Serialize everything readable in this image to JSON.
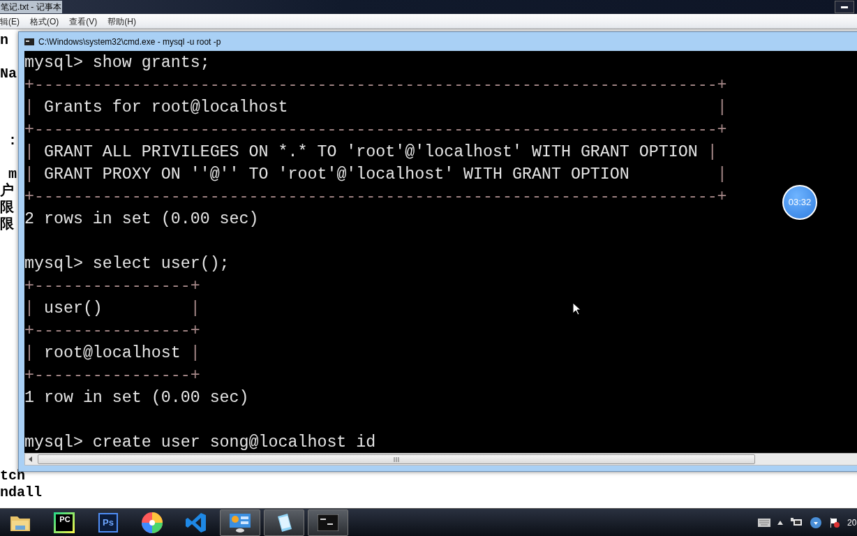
{
  "notepad": {
    "title": "笔记.txt - 记事本",
    "menu": [
      "辑(E)",
      "格式(O)",
      "查看(V)",
      "帮助(H)"
    ],
    "lines": [
      {
        "kind": "text",
        "text": "n"
      },
      {
        "kind": "blank"
      },
      {
        "kind": "text",
        "text": "Na"
      },
      {
        "kind": "blank"
      },
      {
        "kind": "blank"
      },
      {
        "kind": "blank"
      },
      {
        "kind": "text",
        "text": " :"
      },
      {
        "kind": "blank"
      },
      {
        "kind": "text",
        "text": " m"
      },
      {
        "kind": "text",
        "text": "户"
      },
      {
        "kind": "text",
        "text": "限"
      },
      {
        "kind": "text",
        "text": "限"
      },
      {
        "kind": "blank"
      },
      {
        "kind": "blank"
      },
      {
        "kind": "blank"
      },
      {
        "kind": "blank"
      },
      {
        "kind": "blank"
      },
      {
        "kind": "blank"
      },
      {
        "kind": "blank"
      },
      {
        "kind": "blank"
      },
      {
        "kind": "blank"
      },
      {
        "kind": "blank"
      },
      {
        "kind": "blank"
      },
      {
        "kind": "blank"
      },
      {
        "kind": "blank"
      },
      {
        "kind": "blank"
      },
      {
        "kind": "text",
        "text": "tch"
      },
      {
        "kind": "text",
        "text": "ndall"
      }
    ]
  },
  "console": {
    "title": "C:\\Windows\\system32\\cmd.exe - mysql  -u root -p",
    "lines": [
      {
        "kind": "text",
        "text": "mysql> show grants;"
      },
      {
        "kind": "border",
        "text": "+----------------------------------------------------------------------+"
      },
      {
        "kind": "row",
        "cells": [
          " Grants for root@localhost                                            "
        ]
      },
      {
        "kind": "border",
        "text": "+----------------------------------------------------------------------+"
      },
      {
        "kind": "row",
        "cells": [
          " GRANT ALL PRIVILEGES ON *.* TO 'root'@'localhost' WITH GRANT OPTION "
        ]
      },
      {
        "kind": "row",
        "cells": [
          " GRANT PROXY ON ''@'' TO 'root'@'localhost' WITH GRANT OPTION         "
        ]
      },
      {
        "kind": "border",
        "text": "+----------------------------------------------------------------------+"
      },
      {
        "kind": "text",
        "text": "2 rows in set (0.00 sec)"
      },
      {
        "kind": "blank"
      },
      {
        "kind": "text",
        "text": "mysql> select user();"
      },
      {
        "kind": "border",
        "text": "+----------------+"
      },
      {
        "kind": "row",
        "cells": [
          " user()         "
        ]
      },
      {
        "kind": "border",
        "text": "+----------------+"
      },
      {
        "kind": "row",
        "cells": [
          " root@localhost "
        ]
      },
      {
        "kind": "border",
        "text": "+----------------+"
      },
      {
        "kind": "text",
        "text": "1 row in set (0.00 sec)"
      },
      {
        "kind": "blank"
      },
      {
        "kind": "text",
        "text": "mysql> create user song@localhost id"
      }
    ],
    "separator": "|"
  },
  "timer": "03:32",
  "taskbar": [
    {
      "kind": "folder",
      "active": false
    },
    {
      "kind": "pycharm",
      "label": "PC",
      "active": false
    },
    {
      "kind": "photoshop",
      "label": "Ps",
      "active": false
    },
    {
      "kind": "colorwheel",
      "active": false
    },
    {
      "kind": "vscode",
      "active": false
    },
    {
      "kind": "panel",
      "active": true
    },
    {
      "kind": "notepad",
      "active": true
    },
    {
      "kind": "terminal",
      "active": true
    }
  ],
  "tray": {
    "clock": "20"
  }
}
